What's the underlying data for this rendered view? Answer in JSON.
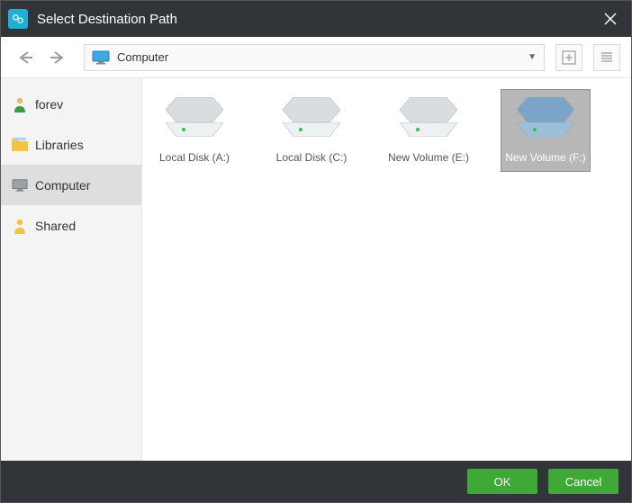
{
  "title": "Select Destination Path",
  "navbar": {
    "path_label": "Computer"
  },
  "sidebar": {
    "items": [
      {
        "id": "user",
        "label": "forev",
        "selected": false
      },
      {
        "id": "libraries",
        "label": "Libraries",
        "selected": false
      },
      {
        "id": "computer",
        "label": "Computer",
        "selected": true
      },
      {
        "id": "shared",
        "label": "Shared",
        "selected": false
      }
    ]
  },
  "content": {
    "drives": [
      {
        "id": "a",
        "label": "Local Disk (A:)",
        "color_top": "#d8dde0",
        "color_front": "#eef1f2",
        "selected": false
      },
      {
        "id": "c",
        "label": "Local Disk (C:)",
        "color_top": "#d8dde0",
        "color_front": "#eef1f2",
        "selected": false
      },
      {
        "id": "e",
        "label": "New Volume (E:)",
        "color_top": "#d8dde0",
        "color_front": "#eef1f2",
        "selected": false
      },
      {
        "id": "f",
        "label": "New Volume (F:)",
        "color_top": "#7ba4c8",
        "color_front": "#9bbfd9",
        "selected": true
      }
    ]
  },
  "footer": {
    "ok": "OK",
    "cancel": "Cancel"
  }
}
